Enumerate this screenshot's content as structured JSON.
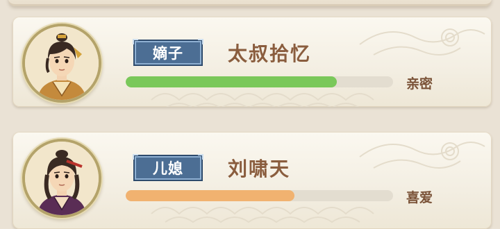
{
  "members": [
    {
      "relation": "嫡子",
      "name": "太叔拾忆",
      "affection_label": "亲密",
      "affection_fraction": 0.79,
      "bar_color": "#7ac85a",
      "avatar_icon": "young-man-with-topknot-portrait"
    },
    {
      "relation": "儿媳",
      "name": "刘啸天",
      "affection_label": "喜爱",
      "affection_fraction": 0.63,
      "bar_color": "#f1b270",
      "avatar_icon": "young-woman-with-hairpin-portrait"
    }
  ]
}
